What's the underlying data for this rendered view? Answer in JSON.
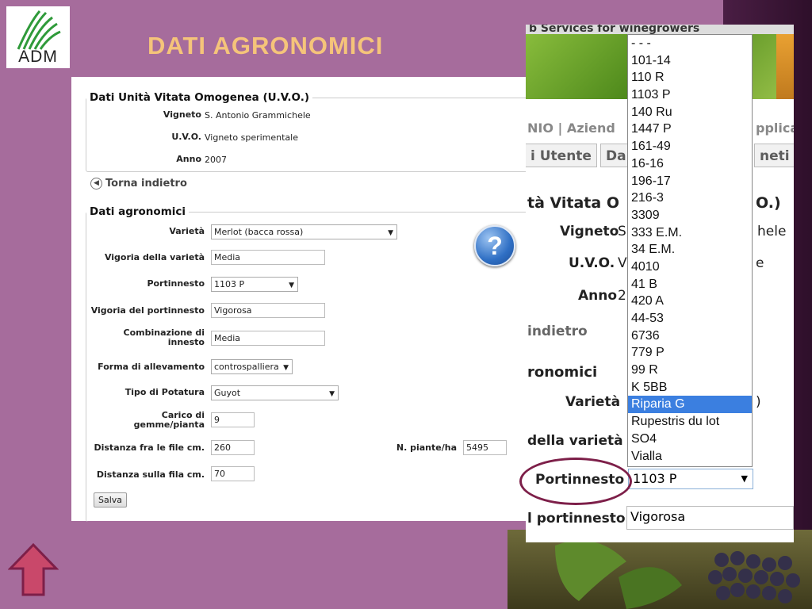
{
  "slide": {
    "logo_text": "ADM",
    "title": "DATI AGRONOMICI"
  },
  "form": {
    "uvo_section": {
      "legend": "Dati Unità Vitata Omogenea (U.V.O.)",
      "fields": [
        {
          "label": "Vigneto",
          "value": "S. Antonio Grammichele"
        },
        {
          "label": "U.V.O.",
          "value": "Vigneto sperimentale"
        },
        {
          "label": "Anno",
          "value": "2007"
        }
      ]
    },
    "back_link": "Torna indietro",
    "agro_section": {
      "legend": "Dati agronomici",
      "varieta_label": "Varietà",
      "varieta_value": "Merlot (bacca rossa)",
      "vigoria_varieta_label": "Vigoria della varietà",
      "vigoria_varieta_value": "Media",
      "portinnesto_label": "Portinnesto",
      "portinnesto_value": "1103 P",
      "vigoria_portinnesto_label": "Vigoria del portinnesto",
      "vigoria_portinnesto_value": "Vigorosa",
      "combinazione_label": "Combinazione di innesto",
      "combinazione_value": "Media",
      "forma_label": "Forma di allevamento",
      "forma_value": "controspalliera",
      "potatura_label": "Tipo di Potatura",
      "potatura_value": "Guyot",
      "carico_label": "Carico di gemme/pianta",
      "carico_value": "9",
      "distanza_file_label": "Distanza fra le file cm.",
      "distanza_file_value": "260",
      "piante_label": "N. piante/ha",
      "piante_value": "5495",
      "distanza_fila_label": "Distanza sulla fila cm.",
      "distanza_fila_value": "70",
      "save_label": "Salva",
      "help_glyph": "?"
    }
  },
  "zoom": {
    "banner_text": "b Services for winegrowers",
    "nav_text": "NIO  |  Aziend",
    "nav_text_right": "pplica",
    "tabs": [
      "i Utente",
      "Da",
      "neti"
    ],
    "heading": "tà Vitata O",
    "heading_right": "O.)",
    "vigneto_label": "Vigneto",
    "vigneto_value": "S",
    "vigneto_value_right": "hele",
    "uvo_label": "U.V.O.",
    "uvo_value": "V",
    "uvo_value_right": "e",
    "anno_label": "Anno",
    "anno_value": "2",
    "back_text": "indietro",
    "section_text": "ronomici",
    "varieta_label": "Varietà",
    "varieta_value_right": ")",
    "vigoria_label": "della varietà",
    "portinnesto_label": "Portinnesto",
    "portinnesto_value": "1103 P",
    "vigoria_port_label": "l portinnesto",
    "vigoria_port_value": "Vigorosa",
    "dropdown_options": [
      "- - -",
      "101-14",
      "110 R",
      "1103 P",
      "140 Ru",
      "1447 P",
      "161-49",
      "16-16",
      "196-17",
      "216-3",
      "3309",
      "333 E.M.",
      "34 E.M.",
      "4010",
      "41 B",
      "420 A",
      "44-53",
      "6736",
      "779 P",
      "99 R",
      "K 5BB",
      "Riparia G",
      "Rupestris du lot",
      "SO4",
      "Vialla"
    ],
    "dropdown_highlighted": "Riparia G"
  },
  "colors": {
    "background": "#a66c9c",
    "title": "#f5c47a",
    "highlight": "#3b7fe0",
    "ellipse": "#7d1f49",
    "arrow": "#c9486a"
  }
}
